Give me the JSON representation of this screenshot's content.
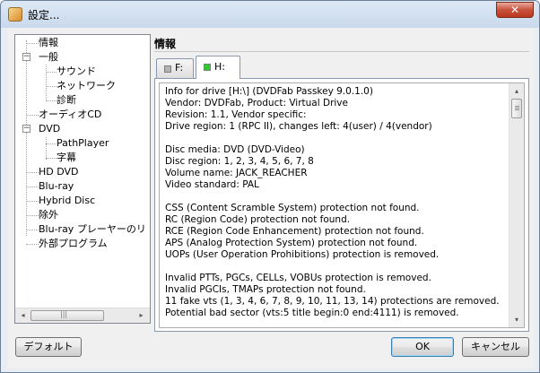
{
  "window": {
    "title": "設定...",
    "close_label": "✕"
  },
  "tree": {
    "items": [
      {
        "label": "情報"
      },
      {
        "label": "一般"
      },
      {
        "label": "サウンド"
      },
      {
        "label": "ネットワーク"
      },
      {
        "label": "診断"
      },
      {
        "label": "オーディオCD"
      },
      {
        "label": "DVD"
      },
      {
        "label": "PathPlayer"
      },
      {
        "label": "字幕"
      },
      {
        "label": "HD DVD"
      },
      {
        "label": "Blu-ray"
      },
      {
        "label": "Hybrid Disc"
      },
      {
        "label": "除外"
      },
      {
        "label": "Blu-ray プレーヤーのリ"
      },
      {
        "label": "外部プログラム"
      }
    ],
    "scroll_left": "◂",
    "scroll_right": "▸",
    "scroll_grip": "|||"
  },
  "panel": {
    "title": "情報",
    "tabs": [
      {
        "label": "F:",
        "led_color": "#b3b3b3",
        "active": false
      },
      {
        "label": "H:",
        "led_color": "#2fcc2f",
        "active": true
      }
    ],
    "info_lines": [
      "Info for drive [H:\\] (DVDFab Passkey 9.0.1.0)",
      "Vendor: DVDFab, Product: Virtual Drive",
      "Revision: 1.1, Vendor specific:",
      "Drive region: 1 (RPC II), changes left: 4(user) / 4(vendor)",
      "",
      "Disc media: DVD (DVD-Video)",
      "Disc region: 1, 2, 3, 4, 5, 6, 7, 8",
      "Volume name: JACK_REACHER",
      "Video standard: PAL",
      "",
      "CSS (Content Scramble System) protection not found.",
      "RC (Region Code) protection not found.",
      "RCE (Region Code Enhancement) protection not found.",
      "APS (Analog Protection System) protection not found.",
      "UOPs (User Operation Prohibitions) protection is removed.",
      "",
      "Invalid PTTs, PGCs, CELLs, VOBUs protection is removed.",
      "Invalid PGCIs, TMAPs protection not found.",
      "11 fake vts (1, 3, 4, 6, 7, 8, 9, 10, 11, 13, 14) protections are removed.",
      "Potential bad sector (vts:5 title begin:0 end:4111) is removed."
    ],
    "scroll_up": "▴",
    "scroll_down": "▾"
  },
  "buttons": {
    "default_label": "デフォルト",
    "ok_label": "OK",
    "cancel_label": "キャンセル"
  },
  "colors": {
    "titlebar": "#c9d9ec",
    "close_button": "#c8523c",
    "led_active": "#2fcc2f",
    "led_inactive": "#b3b3b3"
  }
}
